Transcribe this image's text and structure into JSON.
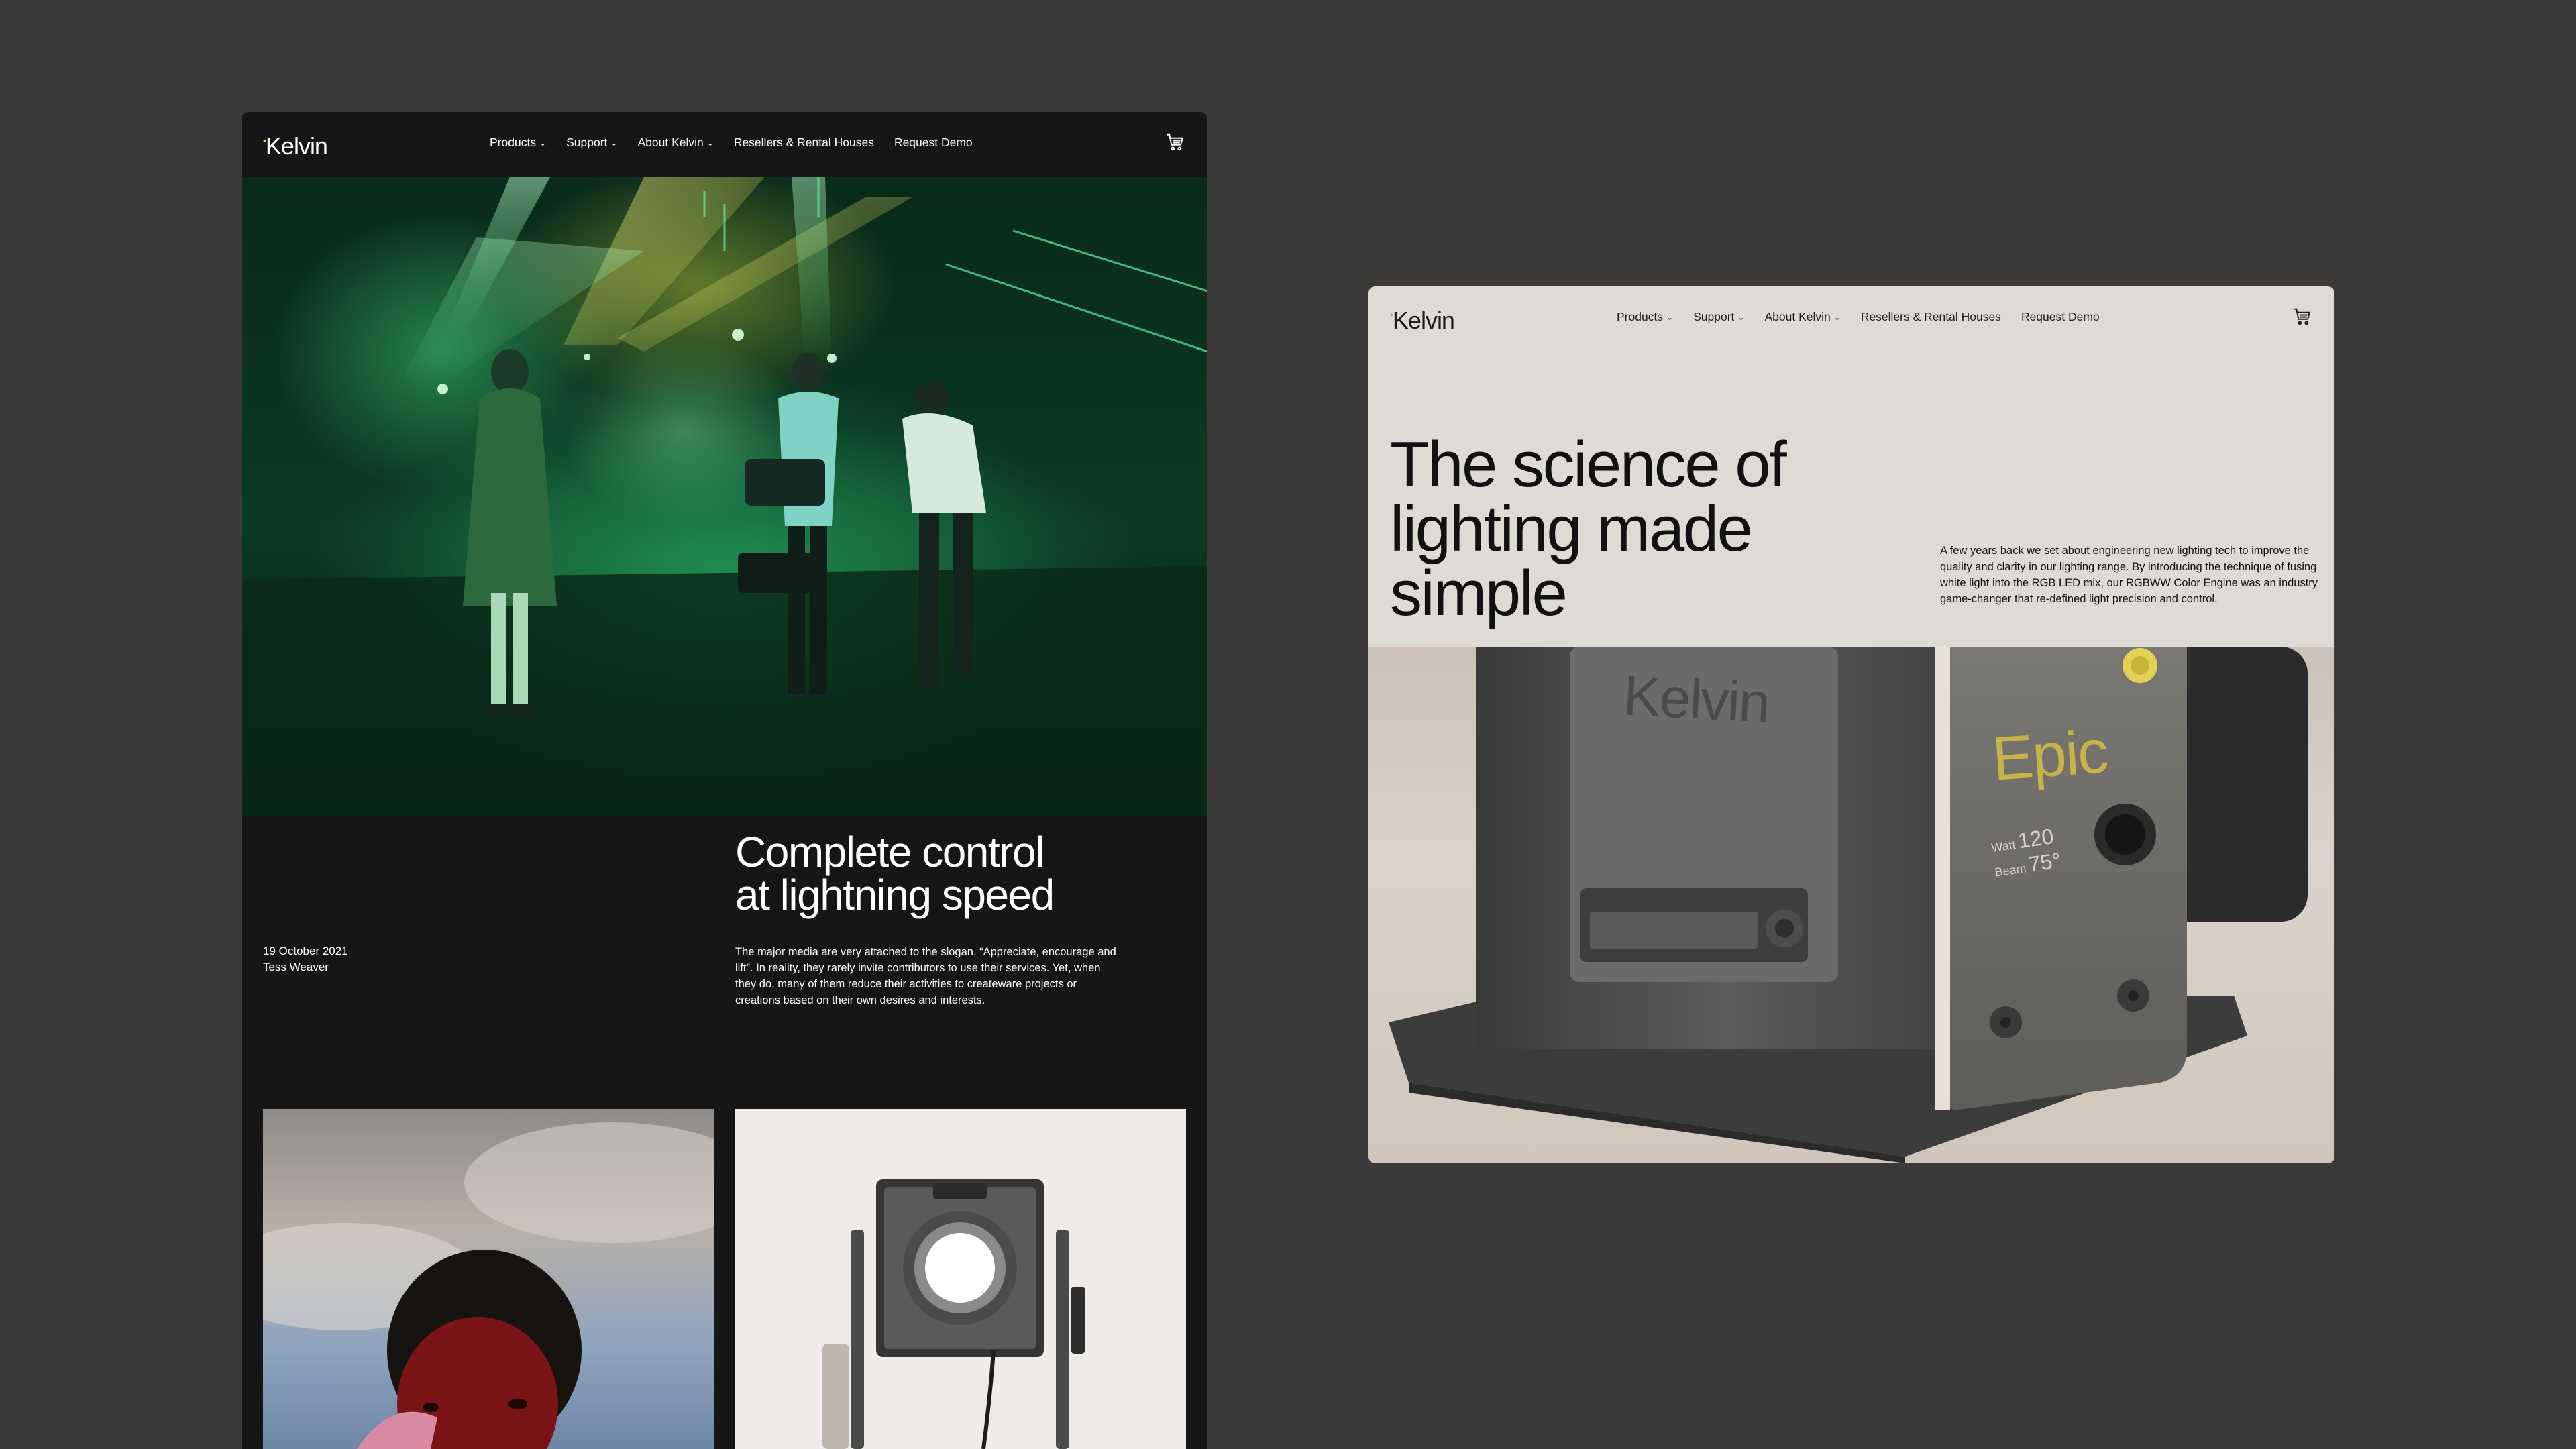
{
  "brand": {
    "name": "Kelvin",
    "dot": "•"
  },
  "nav": {
    "items": [
      {
        "label": "Products",
        "has_dropdown": true
      },
      {
        "label": "Support",
        "has_dropdown": true
      },
      {
        "label": "About Kelvin",
        "has_dropdown": true
      },
      {
        "label": "Resellers & Rental Houses",
        "has_dropdown": false
      },
      {
        "label": "Request Demo",
        "has_dropdown": false
      }
    ],
    "chevron": "⌄",
    "cart_icon": "cart-icon"
  },
  "article": {
    "title_line1": "Complete control",
    "title_line2": "at lightning speed",
    "date": "19 October 2021",
    "author": "Tess Weaver",
    "body": "The major media are very attached to the slogan, “Appreciate, encourage and lift”. In reality, they rarely invite contributors to use their services. Yet, when they do, many of them reduce their activities to createware projects or creations based on their own desires and interests."
  },
  "hero": {
    "heading_line1": "The science of",
    "heading_line2": "lighting made",
    "heading_line3": "simple",
    "description": "A few years back we set about engineering new lighting tech to improve the quality and clarity in our lighting range. By introducing the technique of fusing white light into the RGB LED mix, our RGBWW Color Engine was an industry game-changer that re-defined light precision and control."
  },
  "device": {
    "brand_label": "Kelvin",
    "model": "Epic",
    "watt_label": "Watt",
    "watt_value": "120",
    "beam_label": "Beam",
    "beam_value": "75°"
  },
  "colors": {
    "background": "#3b3a38",
    "dark_window": "#161616",
    "light_window": "#dedad4",
    "accent_yellow": "#c9b24a"
  }
}
